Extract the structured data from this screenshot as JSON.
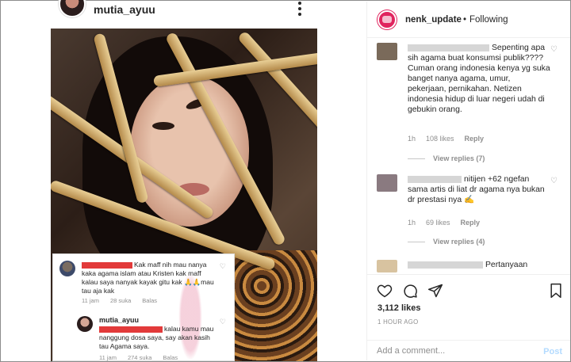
{
  "post": {
    "username": "mutia_ayuu"
  },
  "overlay": {
    "comment1": {
      "text": "Kak maff nih mau nanya kaka agama islam atau Kristen kak maff kalau saya nanyak kayak gitu kak 🙏🙏mau tau aja kak",
      "time": "11 jam",
      "likes": "28 suka",
      "reply": "Balas"
    },
    "comment2": {
      "name": "mutia_ayuu",
      "text": "kalau kamu mau nanggung dosa saya, say akan kasih tau Agama saya.",
      "time": "11 jam",
      "likes": "274 suka",
      "reply": "Balas"
    }
  },
  "header": {
    "username": "nenk_update",
    "separator": "•",
    "follow_status": "Following"
  },
  "comments": [
    {
      "text": "Sepenting apa sih agama buat konsumsi publik???? Cuman orang indonesia kenya yg suka banget nanya agama, umur, pekerjaan, pernikahan. Netizen indonesia hidup di luar negeri udah di gebukin orang.",
      "time": "1h",
      "likes": "108 likes",
      "reply": "Reply",
      "view_replies": "View replies (7)",
      "avatar_color": "#7a6a5a"
    },
    {
      "text": "nitijen +62 ngefan sama artis di liat dr agama nya bukan dr prestasi nya ✍️",
      "time": "1h",
      "likes": "69 likes",
      "reply": "Reply",
      "view_replies": "View replies (4)",
      "avatar_color": "#8a7a80"
    },
    {
      "text": "Pertanyaan",
      "avatar_color": "#d8c3a0"
    }
  ],
  "actions": {
    "likes": "3,112 likes",
    "time": "1 HOUR AGO",
    "comment_placeholder": "Add a comment...",
    "post_label": "Post"
  }
}
